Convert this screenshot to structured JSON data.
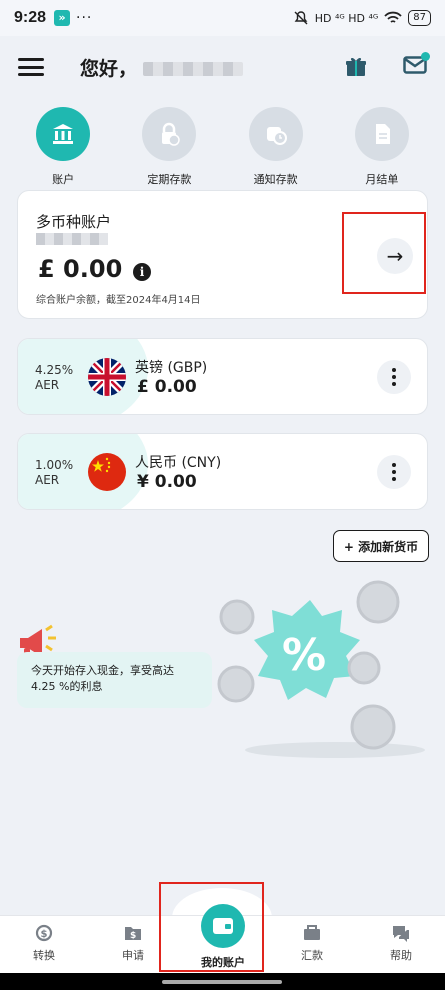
{
  "status": {
    "time": "9:28",
    "app_badge": "»",
    "dots": "···",
    "signal": "HD ⁴ᴳ HD ⁴ᴳ",
    "battery": "87"
  },
  "header": {
    "greeting": "您好，"
  },
  "quick_actions": [
    {
      "label": "账户",
      "icon": "bank-icon",
      "active": true
    },
    {
      "label": "定期存款",
      "icon": "lock-coin-icon",
      "active": false
    },
    {
      "label": "通知存款",
      "icon": "clock-coin-icon",
      "active": false
    },
    {
      "label": "月结单",
      "icon": "document-icon",
      "active": false
    }
  ],
  "multi_account": {
    "title": "多币种账户",
    "balance": "£ 0.00",
    "info": "i",
    "note": "综合账户余额，截至2024年4月14日",
    "arrow": "→"
  },
  "currencies": [
    {
      "rate_pct": "4.25%",
      "rate_unit": "AER",
      "name": "英镑 (GBP)",
      "amount": "£ 0.00",
      "flag": "uk-flag"
    },
    {
      "rate_pct": "1.00%",
      "rate_unit": "AER",
      "name": "人民币 (CNY)",
      "amount": "¥ 0.00",
      "flag": "china-flag"
    }
  ],
  "add_currency": "+ 添加新货币",
  "promo": {
    "text_line1": "今天开始存入现金，享受高达",
    "text_line2": "4.25 %的利息",
    "badge": "%"
  },
  "bottom_nav": [
    {
      "label": "转换",
      "icon": "exchange-icon"
    },
    {
      "label": "申请",
      "icon": "apply-icon"
    },
    {
      "label": "我的账户",
      "icon": "wallet-icon"
    },
    {
      "label": "汇款",
      "icon": "transfer-icon"
    },
    {
      "label": "帮助",
      "icon": "help-icon"
    }
  ],
  "colors": {
    "accent": "#1fb8b0",
    "highlight": "#e0251d",
    "background": "#eef1f6"
  }
}
